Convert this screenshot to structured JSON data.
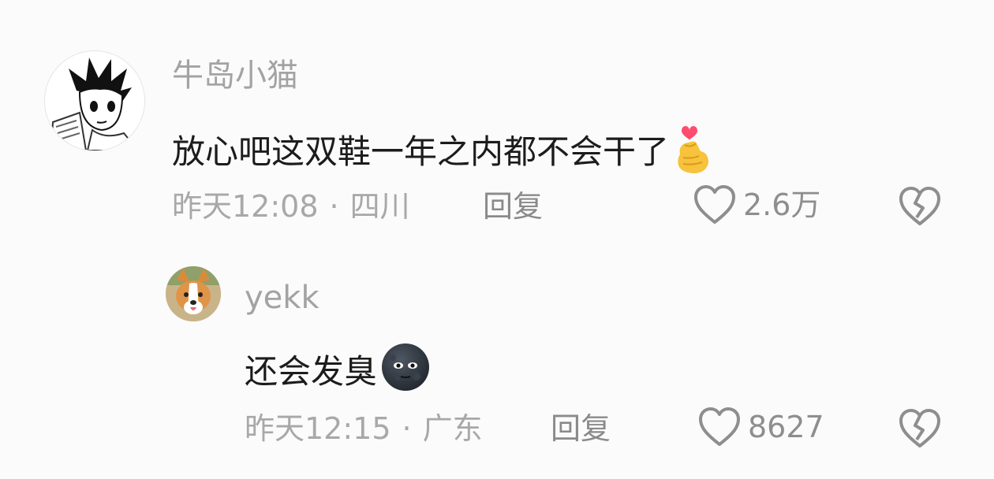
{
  "comments": [
    {
      "username": "牛岛小猫",
      "text": "放心吧这双鞋一年之内都不会干了",
      "emoji": "finger-heart-emoji",
      "time": "昨天12:08",
      "separator": "·",
      "location": "四川",
      "reply_label": "回复",
      "likes": "2.6万",
      "avatar": "manga-boy-avatar"
    },
    {
      "username": "yekk",
      "text": "还会发臭",
      "emoji": "new-moon-face-emoji",
      "time": "昨天12:15",
      "separator": "·",
      "location": "广东",
      "reply_label": "回复",
      "likes": "8627",
      "avatar": "corgi-avatar"
    }
  ],
  "icons": {
    "like": "heart-outline-icon",
    "dislike": "broken-heart-icon"
  },
  "colors": {
    "background": "#fbfbfb",
    "username": "#a3a3a3",
    "text": "#1c1c1c",
    "meta": "#a8a8a8",
    "icon": "#8e8e8e"
  }
}
